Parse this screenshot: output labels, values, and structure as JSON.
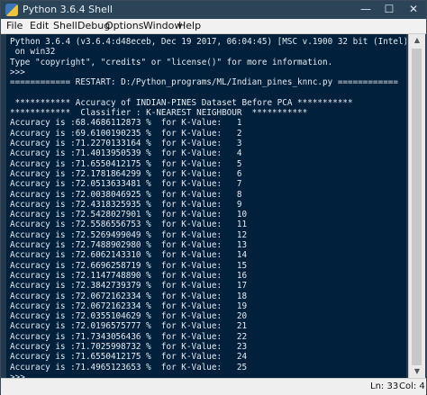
{
  "window": {
    "title": "Python 3.6.4 Shell"
  },
  "titlebar_buttons": {
    "minimize": "—",
    "maximize": "☐",
    "close": "✕"
  },
  "menu": [
    "File",
    "Edit",
    "Shell",
    "Debug",
    "Options",
    "Window",
    "Help"
  ],
  "console": {
    "header": [
      "Python 3.6.4 (v3.6.4:d48eceb, Dec 19 2017, 06:04:45) [MSC v.1900 32 bit (Intel)]",
      " on win32",
      "Type \"copyright\", \"credits\" or \"license()\" for more information."
    ],
    "prompt": ">>>",
    "restart": "============ RESTART: D:/Python_programs/ML/Indian_pines_knnc.py ============",
    "title1": " *********** Accuracy of INDIAN-PINES Dataset Before PCA ***********",
    "title2": "************  Classifier : K-NEAREST NEIGHBOUR  ***********",
    "results": [
      {
        "acc": "68.4686112873",
        "k": "1"
      },
      {
        "acc": "69.6100190235",
        "k": "2"
      },
      {
        "acc": "71.2270133164",
        "k": "3"
      },
      {
        "acc": "71.4013950539",
        "k": "4"
      },
      {
        "acc": "71.6550412175",
        "k": "5"
      },
      {
        "acc": "72.1781864299",
        "k": "6"
      },
      {
        "acc": "72.0513633481",
        "k": "7"
      },
      {
        "acc": "72.0038046925",
        "k": "8"
      },
      {
        "acc": "72.4318325935",
        "k": "9"
      },
      {
        "acc": "72.5428027901",
        "k": "10"
      },
      {
        "acc": "72.5586556753",
        "k": "11"
      },
      {
        "acc": "72.5269499049",
        "k": "12"
      },
      {
        "acc": "72.7488902980",
        "k": "13"
      },
      {
        "acc": "72.6062143310",
        "k": "14"
      },
      {
        "acc": "72.6696258719",
        "k": "15"
      },
      {
        "acc": "72.1147748890",
        "k": "16"
      },
      {
        "acc": "72.3842739379",
        "k": "17"
      },
      {
        "acc": "72.0672162334",
        "k": "18"
      },
      {
        "acc": "72.0672162334",
        "k": "19"
      },
      {
        "acc": "72.0355104629",
        "k": "20"
      },
      {
        "acc": "72.0196575777",
        "k": "21"
      },
      {
        "acc": "71.7343056436",
        "k": "22"
      },
      {
        "acc": "71.7025998732",
        "k": "23"
      },
      {
        "acc": "71.6550412175",
        "k": "24"
      },
      {
        "acc": "71.4965123653",
        "k": "25"
      }
    ]
  },
  "status": {
    "ln": "Ln: 33",
    "col": "Col: 4"
  }
}
